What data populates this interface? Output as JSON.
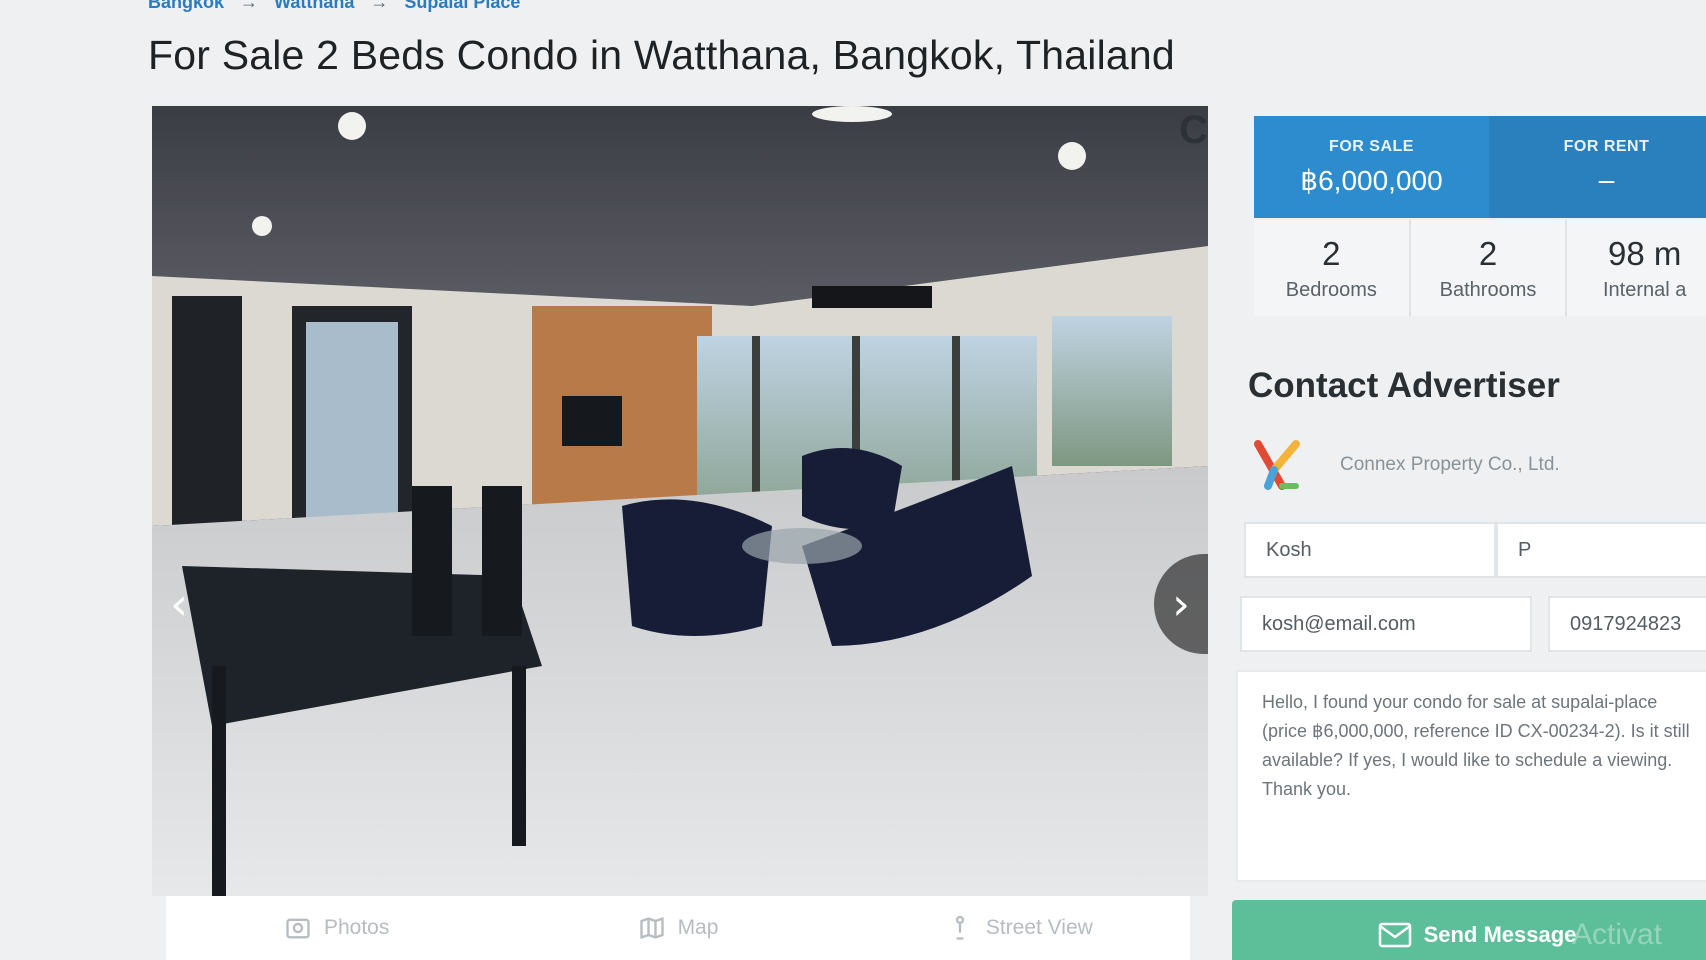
{
  "breadcrumb": {
    "items": [
      "Bangkok",
      "Watthana",
      "Supalai Place"
    ],
    "separator": "→"
  },
  "page_title": "For Sale 2 Beds Condo in Watthana, Bangkok, Thailand",
  "gallery": {
    "corner_text": "C",
    "prev_icon": "chevron-left-icon",
    "next_icon": "chevron-right-icon",
    "tabs": [
      {
        "label": "Photos",
        "icon": "photo-icon"
      },
      {
        "label": "Map",
        "icon": "map-icon"
      },
      {
        "label": "Street View",
        "icon": "person-icon"
      }
    ]
  },
  "price": {
    "sale_label": "FOR SALE",
    "sale_value": "฿6,000,000",
    "rent_label": "FOR RENT",
    "rent_value": "–"
  },
  "stats": [
    {
      "value": "2",
      "label": "Bedrooms"
    },
    {
      "value": "2",
      "label": "Bathrooms"
    },
    {
      "value": "98 m",
      "label": "Internal a"
    }
  ],
  "contact": {
    "title": "Contact Advertiser",
    "agency_name": "Connex Property Co., Ltd.",
    "first_name": "Kosh",
    "last_name": "P",
    "email": "kosh@email.com",
    "phone": "0917924823",
    "message": "Hello, I found your condo for sale at supalai-place (price ฿6,000,000, reference ID CX-00234-2). Is it still available? If yes, I would like to schedule a viewing. Thank you.",
    "send_label": "Send Message",
    "watermark": "Activat"
  },
  "colors": {
    "sale_bg": "#2c8ccd",
    "rent_bg": "#2a7fbd",
    "send_bg": "#5cbf9a",
    "link": "#2a7cc0"
  }
}
